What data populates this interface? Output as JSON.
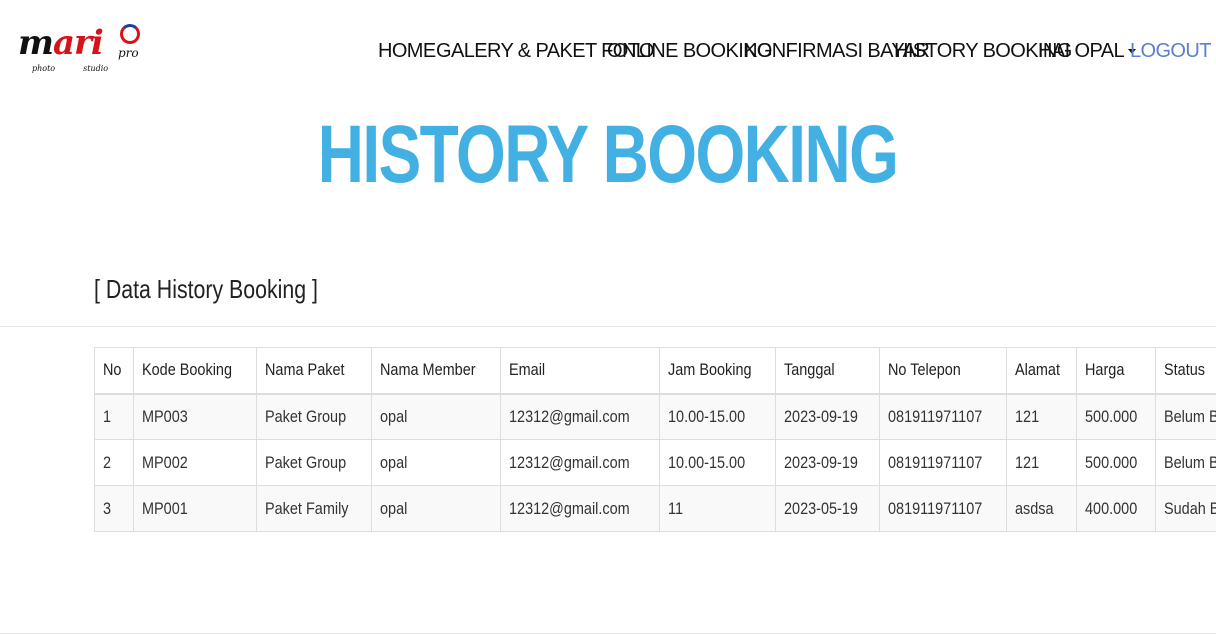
{
  "brand": {
    "logo_word_left": "m",
    "logo_word_red": "ari",
    "logo_pro": "pro",
    "logo_sub_left": "photo",
    "logo_sub_right": "studio"
  },
  "nav": {
    "items": [
      "HOME",
      "GALERY & PAKET FOTO",
      "ONLINE BOOKING",
      "KONFIRMASI BAYAR",
      "HISTORY BOOKING"
    ],
    "user_menu": "HAI OPAL",
    "logout": "LOGOUT"
  },
  "colors": {
    "accent": "#42b0e3",
    "logout_link": "#5b7fd0",
    "logo_red": "#d6131b"
  },
  "page": {
    "title": "HISTORY BOOKING",
    "section_title": "[ Data History Booking ]"
  },
  "table": {
    "headers": [
      "No",
      "Kode Booking",
      "Nama Paket",
      "Nama Member",
      "Email",
      "Jam Booking",
      "Tanggal",
      "No Telepon",
      "Alamat",
      "Harga",
      "Status"
    ],
    "rows": [
      [
        "1",
        "MP003",
        "Paket Group",
        "opal",
        "12312@gmail.com",
        "10.00-15.00",
        "2023-09-19",
        "081911971107",
        "121",
        "500.000",
        "Belum Bayar"
      ],
      [
        "2",
        "MP002",
        "Paket Group",
        "opal",
        "12312@gmail.com",
        "10.00-15.00",
        "2023-09-19",
        "081911971107",
        "121",
        "500.000",
        "Belum Bayar"
      ],
      [
        "3",
        "MP001",
        "Paket Family",
        "opal",
        "12312@gmail.com",
        "11",
        "2023-05-19",
        "081911971107",
        "asdsa",
        "400.000",
        "Sudah Bayar"
      ]
    ]
  }
}
